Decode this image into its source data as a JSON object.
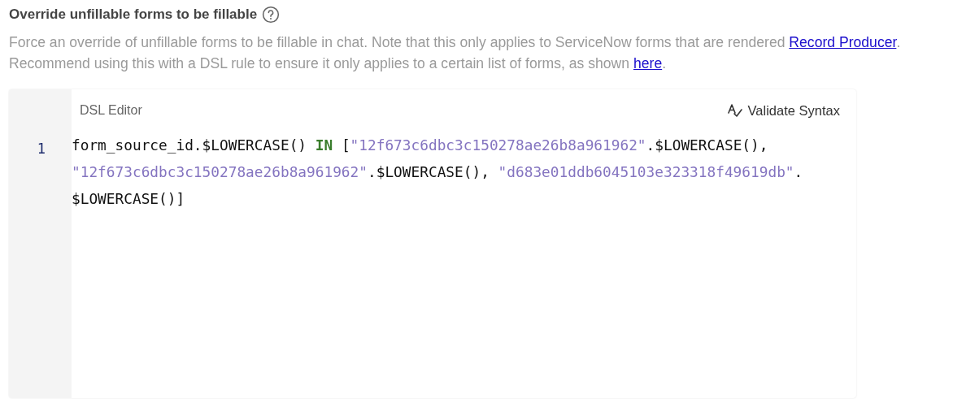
{
  "setting": {
    "title": "Override unfillable forms to be fillable",
    "description": [
      {
        "kind": "text",
        "text": "Force an override of unfillable forms to be fillable in chat. Note that this only applies to ServiceNow forms that are rendered "
      },
      {
        "kind": "link",
        "text": "Record Producer"
      },
      {
        "kind": "text",
        "text": ". Recommend using this with a DSL rule to ensure it only applies to a certain list of forms, as shown "
      },
      {
        "kind": "link",
        "text": "here"
      },
      {
        "kind": "text",
        "text": "."
      }
    ]
  },
  "editor": {
    "title": "DSL Editor",
    "validate_button": "Validate Syntax",
    "lines": [
      {
        "number": "1",
        "tokens": [
          {
            "kind": "plain",
            "text": "form_source_id.$LOWERCASE() "
          },
          {
            "kind": "keyword",
            "text": "IN"
          },
          {
            "kind": "plain",
            "text": " ["
          },
          {
            "kind": "string",
            "text": "\"12f673c6dbc3c150278ae26b8a961962\""
          },
          {
            "kind": "plain",
            "text": ".$LOWERCASE(), "
          },
          {
            "kind": "string",
            "text": "\"12f673c6dbc3c150278ae26b8a961962\""
          },
          {
            "kind": "plain",
            "text": ".$LOWERCASE(), "
          },
          {
            "kind": "string",
            "text": "\"d683e01ddb6045103e323318f49619db\""
          },
          {
            "kind": "plain",
            "text": "."
          },
          {
            "kind": "plain",
            "text": "$LOWERCASE()]"
          }
        ]
      }
    ]
  }
}
